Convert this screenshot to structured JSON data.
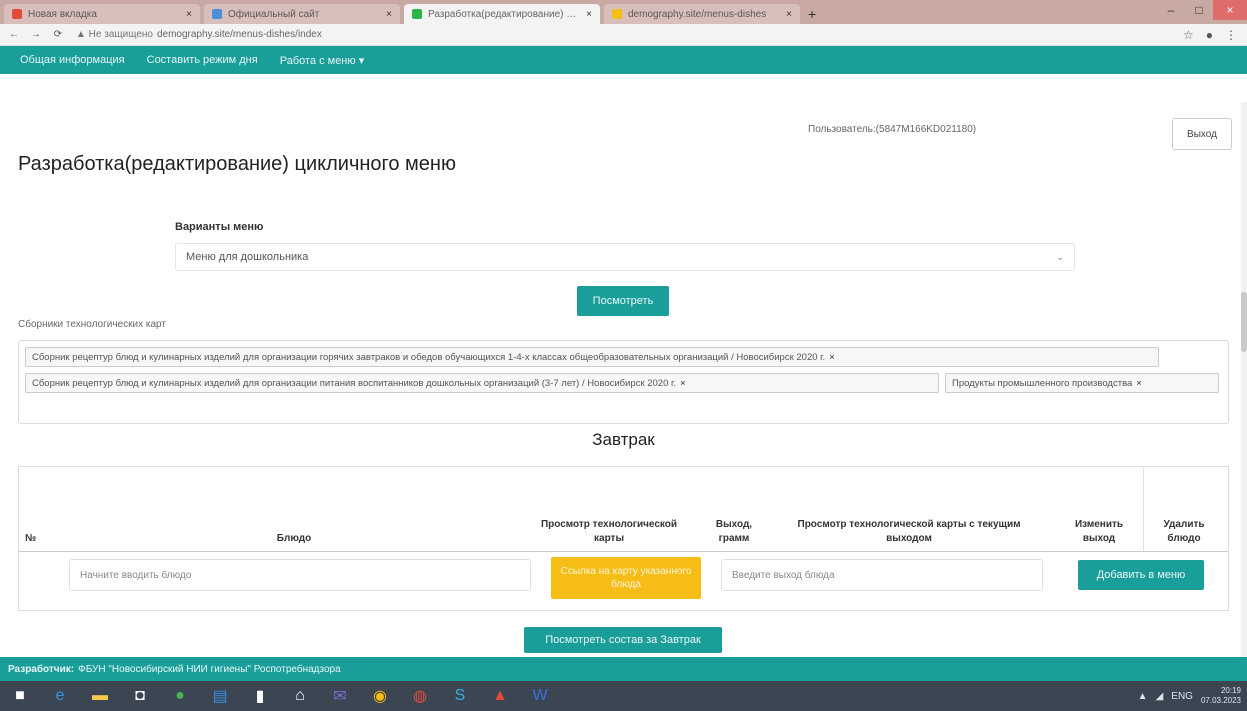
{
  "browser": {
    "tabs": [
      {
        "title": "Новая вкладка",
        "color": "#e34b3a",
        "active": false
      },
      {
        "title": "Официальный сайт",
        "color": "#4a90d9",
        "active": false
      },
      {
        "title": "Разработка(редактирование) циклично",
        "color": "#2cb34a",
        "active": true
      },
      {
        "title": "demography.site/menus-dishes",
        "color": "#f5bd16",
        "active": false
      }
    ],
    "new_tab": "+",
    "url_warning": "▲ Не защищено",
    "url": "demography.site/menus-dishes/index",
    "minimize": "–",
    "maximize": "□",
    "close": "×"
  },
  "nav": {
    "items": [
      "Общая информация",
      "Составить режим дня",
      "Работа с меню ▾"
    ]
  },
  "user": {
    "line": "Пользователь:(5847M166KD021180)",
    "logout": "Выход"
  },
  "page": {
    "title": "Разработка(редактирование) цикличного меню"
  },
  "variants": {
    "label": "Варианты меню",
    "selected": "Меню для дошкольника",
    "chevron": "⌄"
  },
  "view_button": "Посмотреть",
  "collections": {
    "label": "Сборники технологических карт",
    "tags": [
      "Сборник рецептур блюд и кулинарных изделий для организации горячих завтраков и обедов обучающихся 1-4-х классах общеобразовательных организаций / Новосибирск 2020 г.",
      "Сборник рецептур блюд и кулинарных изделий для организации питания воспитанников дошкольных организаций (3-7 лет) / Новосибирск 2020 г.",
      "Продукты промышленного производства"
    ],
    "remove_glyph": "×"
  },
  "meal": {
    "title": "Завтрак",
    "columns": {
      "num": "№",
      "dish": "Блюдо",
      "card": "Просмотр технологической карты",
      "yield": "Выход, грамм",
      "card_current": "Просмотр технологической карты с текущим выходом",
      "change": "Изменить выход",
      "delete": "Удалить блюдо"
    },
    "dish_placeholder": "Начните вводить блюдо",
    "card_button": "Ссылка на карту указанного блюда",
    "yield_placeholder": "Введите выход блюда",
    "add_button": "Добавить в меню"
  },
  "view_composition_button": "Посмотреть состав за Завтрак",
  "footer": {
    "label": "Разработчик:",
    "text": "ФБУН \"Новосибирский НИИ гигиены\" Роспотребнадзора"
  },
  "taskbar": {
    "icons": [
      "windows-icon",
      "edge-icon",
      "explorer-icon",
      "store-icon",
      "utorrent-icon",
      "app-icon",
      "file-icon",
      "home-icon",
      "mail-icon",
      "app2-icon",
      "chrome-icon",
      "skype-icon",
      "pdf-icon",
      "word-icon"
    ],
    "tray_text": "ENG",
    "clock_time": "20:19",
    "clock_date": "07.03.2023"
  }
}
